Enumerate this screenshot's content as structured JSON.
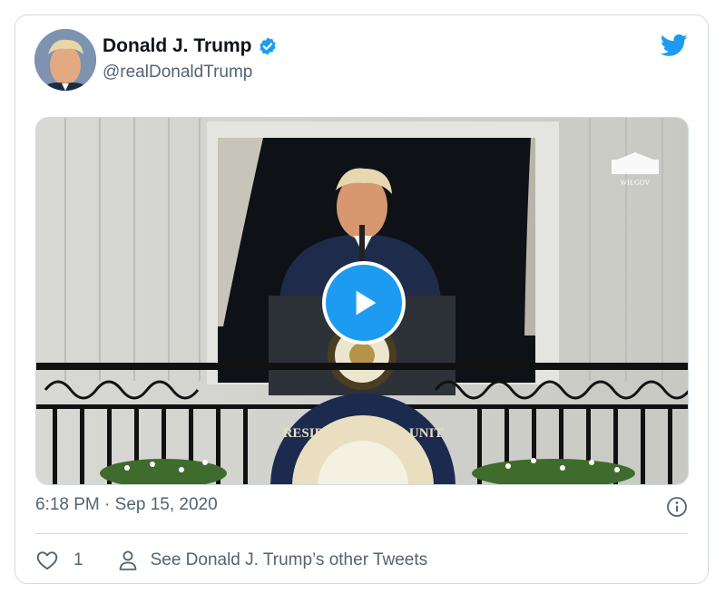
{
  "author": {
    "name": "Donald J. Trump",
    "handle": "@realDonaldTrump",
    "verified": true
  },
  "tweet": {
    "timestamp": "6:18 PM · Sep 15, 2020",
    "like_count": "1",
    "other_tweets_label": "See Donald J. Trump’s other Tweets"
  },
  "media": {
    "watermark": "WH.GOV",
    "seal_text": "RESIDENT OF THE UNIT"
  },
  "icons": {
    "bird": "twitter-bird-icon",
    "verified": "verified-badge-icon",
    "play": "play-icon",
    "info": "info-icon",
    "heart": "heart-icon",
    "person": "person-icon"
  },
  "colors": {
    "accent": "#1d9bf0",
    "text_primary": "#0f1419",
    "text_secondary": "#536471",
    "border": "#cfd9de"
  }
}
